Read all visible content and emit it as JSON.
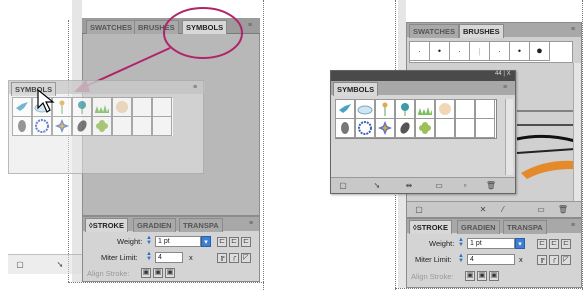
{
  "left": {
    "top_tabs": [
      "SWATCHES",
      "BRUSHES",
      "SYMBOLS"
    ],
    "floating_title": "SYMBOLS",
    "stroke_tabs": [
      "STROKE",
      "GRADIEN",
      "TRANSPA"
    ],
    "weight_label": "Weight:",
    "weight_value": "1 pt",
    "miter_label": "Miter Limit:",
    "miter_value": "4",
    "miter_x": "x",
    "align_label": "Align Stroke:"
  },
  "right": {
    "top_tabs": [
      "SWATCHES",
      "BRUSHES"
    ],
    "symbols_title": "SYMBOLS",
    "collapse_label": "44 | X",
    "stroke_tabs": [
      "STROKE",
      "GRADIEN",
      "TRANSPA"
    ],
    "weight_label": "Weight:",
    "weight_value": "1 pt",
    "miter_label": "Miter Limit:",
    "miter_value": "4",
    "miter_x": "x",
    "align_label": "Align Stroke:"
  },
  "colors": {
    "highlight_ring": "#b0246a",
    "arrow": "#b0246a",
    "dock_gray": "#b8b8b8",
    "panel_light": "#d6d6d6",
    "accent_blue": "#3d7fd6"
  }
}
